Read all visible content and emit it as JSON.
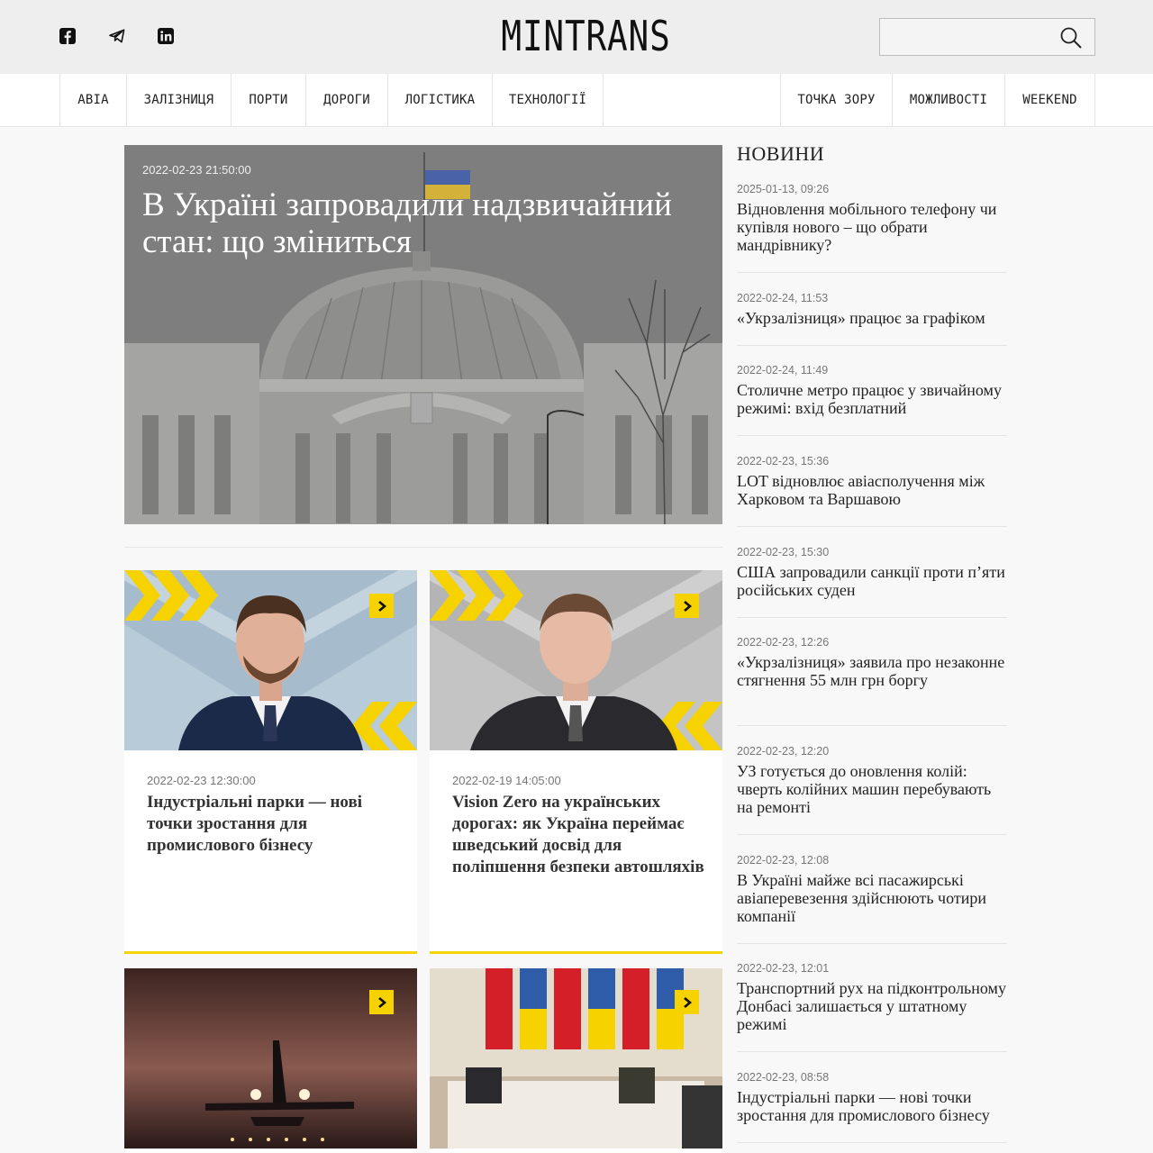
{
  "header": {
    "logo": "MINTRANS",
    "search": {
      "value": "",
      "placeholder": ""
    },
    "social": [
      "facebook-icon",
      "telegram-icon",
      "linkedin-icon"
    ]
  },
  "nav": {
    "left": [
      "АВІА",
      "ЗАЛІЗНИЦЯ",
      "ПОРТИ",
      "ДОРОГИ",
      "ЛОГІСТИКА",
      "ТЕХНОЛОГІЇ"
    ],
    "right": [
      "ТОЧКА ЗОРУ",
      "МОЖЛИВОСТІ",
      "WEEKEND"
    ]
  },
  "hero": {
    "date": "2022-02-23 21:50:00",
    "title": "В Україні запровадили надзвичайний стан: що зміниться"
  },
  "cards": [
    {
      "date": "2022-02-23 12:30:00",
      "title": "Індустріальні парки — нові точки зростання для промислового бізнесу"
    },
    {
      "date": "2022-02-19 14:05:00",
      "title": "Vision Zero на українських дорогах: як Україна переймає шведський досвід для поліпшення безпеки автошляхів"
    },
    {
      "date": "",
      "title": ""
    },
    {
      "date": "",
      "title": ""
    }
  ],
  "news": {
    "heading": "НОВИНИ",
    "items": [
      {
        "date": "2025-01-13, 09:26",
        "title": "Відновлення мобільного телефону чи купівля нового – що обрати мандрівнику?"
      },
      {
        "date": "2022-02-24, 11:53",
        "title": "«Укрзалізниця» працює за графіком"
      },
      {
        "date": "2022-02-24, 11:49",
        "title": "Столичне метро працює у звичайному режимі: вхід безплатний"
      },
      {
        "date": "2022-02-23, 15:36",
        "title": "LOT відновлює авіасполучення між Харковом та Варшавою"
      },
      {
        "date": "2022-02-23, 15:30",
        "title": "США запровадили санкції проти п’яти російських суден"
      },
      {
        "date": "2022-02-23, 12:26",
        "title": "«Укрзалізниця» заявила про незаконне стягнення 55 млн грн боргу"
      },
      {
        "date": "2022-02-23, 12:20",
        "title": "УЗ готується до оновлення колій: чверть колійних машин перебувають на ремонті"
      },
      {
        "date": "2022-02-23, 12:08",
        "title": "В Україні майже всі пасажирські авіаперевезення здійснюють чотири компанії"
      },
      {
        "date": "2022-02-23, 12:01",
        "title": "Транспортний рух на підконтрольному Донбасі залишається у штатному режимі"
      },
      {
        "date": "2022-02-23, 08:58",
        "title": "Індустріальні парки — нові точки зростання для промислового бізнесу"
      }
    ]
  },
  "colors": {
    "accent": "#f5d200",
    "header_bg": "#eeeeee",
    "page_bg": "#f8f8f8"
  }
}
